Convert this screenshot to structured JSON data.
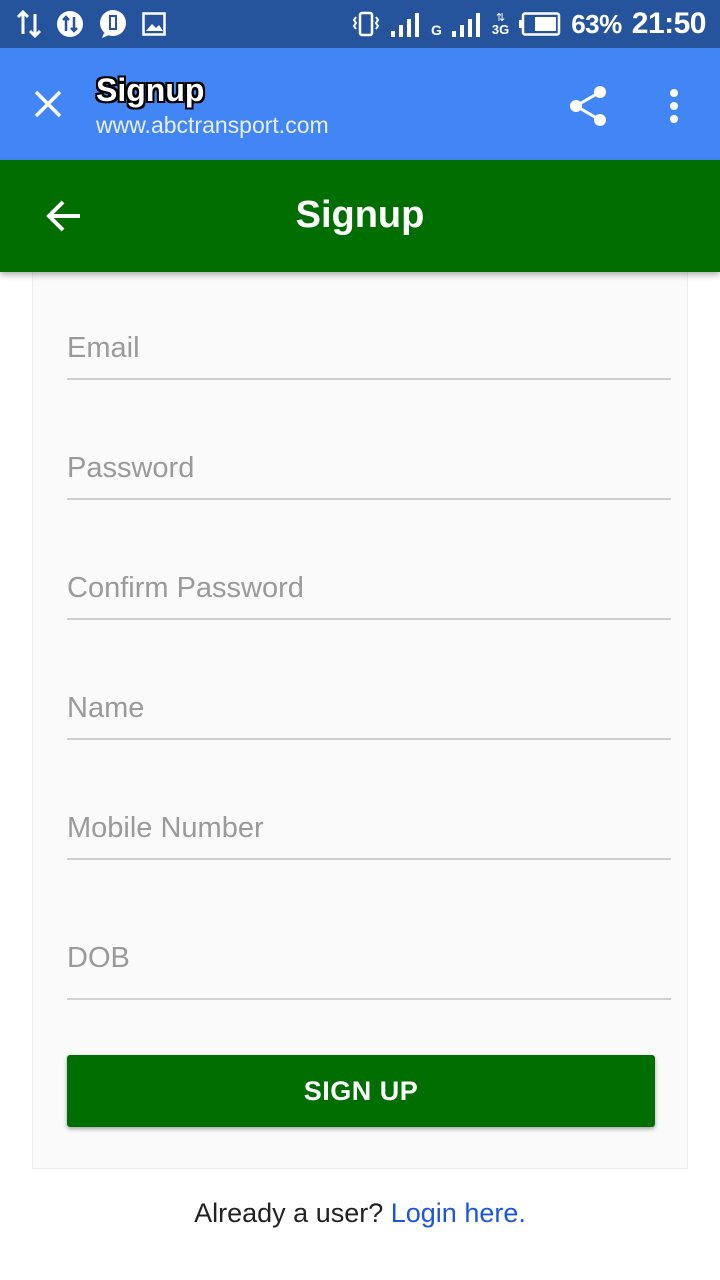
{
  "status_bar": {
    "battery_percent": "63%",
    "time": "21:50",
    "network_g": "G",
    "network_3g": "3G",
    "icons": [
      "data-transfer-icon",
      "sync-icon",
      "notification-badge-icon",
      "image-icon",
      "vibrate-icon",
      "signal-icon",
      "battery-icon"
    ]
  },
  "chrome": {
    "title": "Signup",
    "url": "www.abctransport.com",
    "icons": [
      "close-icon",
      "share-icon",
      "more-vert-icon"
    ]
  },
  "app_bar": {
    "title": "Signup",
    "color": "#006e00"
  },
  "form": {
    "email_placeholder": "Email",
    "password_placeholder": "Password",
    "confirm_password_placeholder": "Confirm Password",
    "name_placeholder": "Name",
    "mobile_placeholder": "Mobile Number",
    "dob_placeholder": "DOB",
    "submit_label": "SIGN UP"
  },
  "footer": {
    "prompt": "Already a user?",
    "link": "Login here."
  },
  "colors": {
    "chrome_blue": "#4285f4",
    "status_blue": "#26549c",
    "brand_green": "#006e00",
    "link_blue": "#1a56d6"
  }
}
